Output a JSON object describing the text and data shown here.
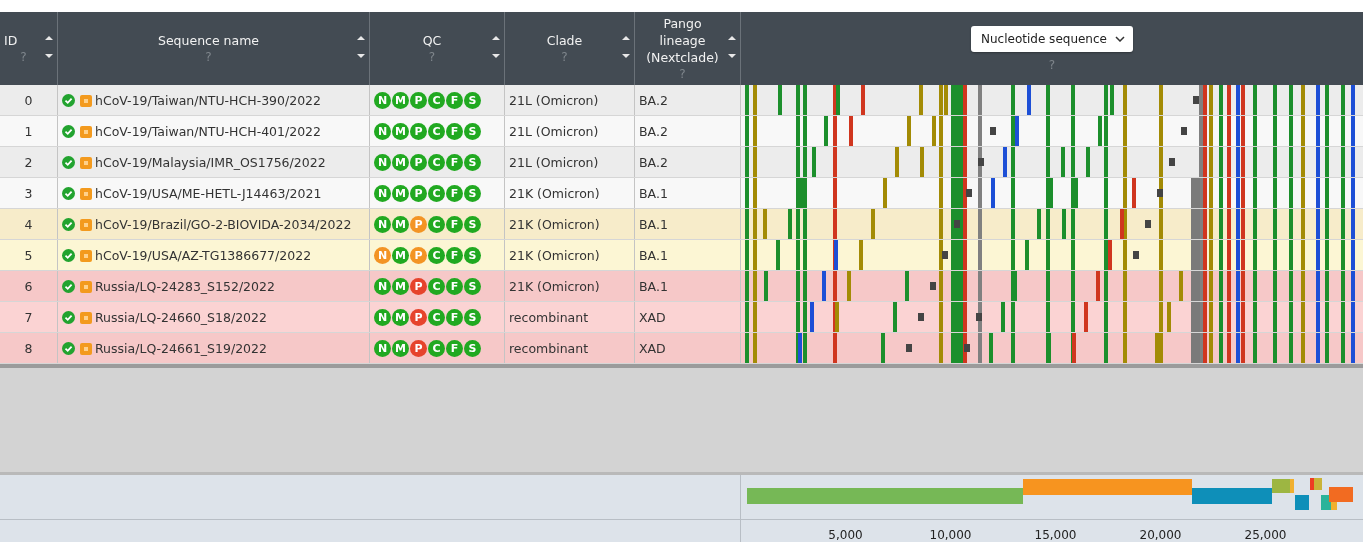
{
  "columns": [
    {
      "label": "ID",
      "help": "?"
    },
    {
      "label": "Sequence name",
      "help": "?"
    },
    {
      "label": "QC",
      "help": "?"
    },
    {
      "label": "Clade",
      "help": "?"
    },
    {
      "label": "Pango lineage (Nextclade)",
      "help": "?"
    }
  ],
  "sequence_column": {
    "dropdown": "Nucleotide sequence",
    "help": "?"
  },
  "rows": [
    {
      "id": "0",
      "name": "hCoV-19/Taiwan/NTU-HCH-390/2022",
      "color": "#ececec",
      "qc": [
        {
          "letter": "N",
          "color": "#21a921"
        },
        {
          "letter": "M",
          "color": "#21a921"
        },
        {
          "letter": "P",
          "color": "#21a921"
        },
        {
          "letter": "C",
          "color": "#21a921"
        },
        {
          "letter": "F",
          "color": "#21a921"
        },
        {
          "letter": "S",
          "color": "#21a921"
        }
      ],
      "clade": "21L (Omicron)",
      "lineage": "BA.2"
    },
    {
      "id": "1",
      "name": "hCoV-19/Taiwan/NTU-HCH-401/2022",
      "color": "#f8f8f8",
      "qc": [
        {
          "letter": "N",
          "color": "#21a921"
        },
        {
          "letter": "M",
          "color": "#21a921"
        },
        {
          "letter": "P",
          "color": "#21a921"
        },
        {
          "letter": "C",
          "color": "#21a921"
        },
        {
          "letter": "F",
          "color": "#21a921"
        },
        {
          "letter": "S",
          "color": "#21a921"
        }
      ],
      "clade": "21L (Omicron)",
      "lineage": "BA.2"
    },
    {
      "id": "2",
      "name": "hCoV-19/Malaysia/IMR_OS1756/2022",
      "color": "#ececec",
      "qc": [
        {
          "letter": "N",
          "color": "#21a921"
        },
        {
          "letter": "M",
          "color": "#21a921"
        },
        {
          "letter": "P",
          "color": "#21a921"
        },
        {
          "letter": "C",
          "color": "#21a921"
        },
        {
          "letter": "F",
          "color": "#21a921"
        },
        {
          "letter": "S",
          "color": "#21a921"
        }
      ],
      "clade": "21L (Omicron)",
      "lineage": "BA.2"
    },
    {
      "id": "3",
      "name": "hCoV-19/USA/ME-HETL-J14463/2021",
      "color": "#f8f8f8",
      "qc": [
        {
          "letter": "N",
          "color": "#21a921"
        },
        {
          "letter": "M",
          "color": "#21a921"
        },
        {
          "letter": "P",
          "color": "#21a921"
        },
        {
          "letter": "C",
          "color": "#21a921"
        },
        {
          "letter": "F",
          "color": "#21a921"
        },
        {
          "letter": "S",
          "color": "#21a921"
        }
      ],
      "clade": "21K (Omicron)",
      "lineage": "BA.1"
    },
    {
      "id": "4",
      "name": "hCoV-19/Brazil/GO-2-BIOVIDA-2034/2022",
      "color": "#f7ecca",
      "qc": [
        {
          "letter": "N",
          "color": "#21a921"
        },
        {
          "letter": "M",
          "color": "#21a921"
        },
        {
          "letter": "P",
          "color": "#f39424"
        },
        {
          "letter": "C",
          "color": "#21a921"
        },
        {
          "letter": "F",
          "color": "#21a921"
        },
        {
          "letter": "S",
          "color": "#21a921"
        }
      ],
      "clade": "21K (Omicron)",
      "lineage": "BA.1"
    },
    {
      "id": "5",
      "name": "hCoV-19/USA/AZ-TG1386677/2022",
      "color": "#fcf6d4",
      "qc": [
        {
          "letter": "N",
          "color": "#f39424"
        },
        {
          "letter": "M",
          "color": "#21a921"
        },
        {
          "letter": "P",
          "color": "#f39424"
        },
        {
          "letter": "C",
          "color": "#21a921"
        },
        {
          "letter": "F",
          "color": "#21a921"
        },
        {
          "letter": "S",
          "color": "#21a921"
        }
      ],
      "clade": "21K (Omicron)",
      "lineage": "BA.1"
    },
    {
      "id": "6",
      "name": "Russia/LQ-24283_S152/2022",
      "color": "#f6c8c8",
      "qc": [
        {
          "letter": "N",
          "color": "#21a921"
        },
        {
          "letter": "M",
          "color": "#21a921"
        },
        {
          "letter": "P",
          "color": "#e6432c"
        },
        {
          "letter": "C",
          "color": "#21a921"
        },
        {
          "letter": "F",
          "color": "#21a921"
        },
        {
          "letter": "S",
          "color": "#21a921"
        }
      ],
      "clade": "21K (Omicron)",
      "lineage": "BA.1"
    },
    {
      "id": "7",
      "name": "Russia/LQ-24660_S18/2022",
      "color": "#fbd3d3",
      "qc": [
        {
          "letter": "N",
          "color": "#21a921"
        },
        {
          "letter": "M",
          "color": "#21a921"
        },
        {
          "letter": "P",
          "color": "#e6432c"
        },
        {
          "letter": "C",
          "color": "#21a921"
        },
        {
          "letter": "F",
          "color": "#21a921"
        },
        {
          "letter": "S",
          "color": "#21a921"
        }
      ],
      "clade": "recombinant",
      "lineage": "XAD"
    },
    {
      "id": "8",
      "name": "Russia/LQ-24661_S19/2022",
      "color": "#f6c8c8",
      "qc": [
        {
          "letter": "N",
          "color": "#21a921"
        },
        {
          "letter": "M",
          "color": "#21a921"
        },
        {
          "letter": "P",
          "color": "#e6432c"
        },
        {
          "letter": "C",
          "color": "#21a921"
        },
        {
          "letter": "F",
          "color": "#21a921"
        },
        {
          "letter": "S",
          "color": "#21a921"
        }
      ],
      "clade": "recombinant",
      "lineage": "XAD"
    }
  ],
  "genome_axis": {
    "ticks": [
      "5,000",
      "10,000",
      "15,000",
      "20,000",
      "25,000"
    ]
  }
}
